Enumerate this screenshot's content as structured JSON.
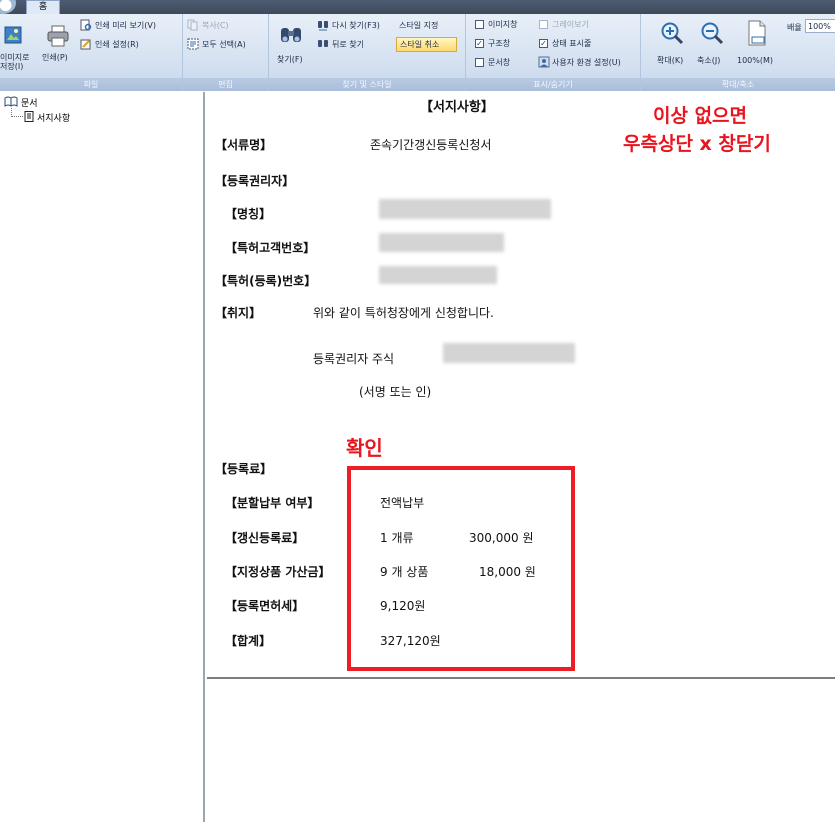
{
  "tab": {
    "home": "홈"
  },
  "ribbon": {
    "file": {
      "label": "파일",
      "save_image_line1": "이미지로",
      "save_image_line2": "저장(I)",
      "print": "인쇄(P)",
      "print_preview": "인쇄 미리 보기(V)",
      "print_settings": "인쇄 설정(R)"
    },
    "edit": {
      "label": "편집",
      "copy": "복사(C)",
      "select_all": "모두 선택(A)"
    },
    "find": {
      "label": "찾기 및 스타일",
      "find": "찾기(F)",
      "find_again": "다시 찾기(F3)",
      "find_back": "뒤로 찾기",
      "style_set": "스타일 지정",
      "style_cancel": "스타일 취소"
    },
    "view": {
      "label": "표시/숨기기",
      "image_pane": "이미지창",
      "grayscale": "그레이보기",
      "structure_pane": "구조창",
      "status_bar": "상태 표시줄",
      "document_pane": "문서창",
      "user_settings": "사용자 환경 설정(U)",
      "checked": {
        "image_pane": false,
        "grayscale": false,
        "structure_pane": true,
        "status_bar": true,
        "document_pane": false
      }
    },
    "zoom": {
      "label": "확대/축소",
      "zoom_in": "확대(K)",
      "zoom_out": "축소(J)",
      "zoom_100": "100%(M)",
      "ratio_label": "배율",
      "ratio_value": "100%"
    }
  },
  "tree": {
    "root": "문서",
    "child": "서지사항"
  },
  "doc": {
    "title": "【서지사항】",
    "doc_name_label": "【서류명】",
    "doc_name_value": "존속기간갱신등록신청서",
    "holder_label": "【등록권리자】",
    "name_label": "【명칭】",
    "customer_no_label": "【특허고객번호】",
    "patent_no_label": "【특허(등록)번호】",
    "purpose_label": "【취지】",
    "purpose_text": "위와 같이 특허청장에게 신청합니다.",
    "signer_text": "등록권리자   주식",
    "signature_text": "(서명 또는 인)",
    "fee_label": "【등록료】",
    "installment_label": "【분할납부 여부】",
    "installment_value": "전액납부",
    "renewal_fee_label": "【갱신등록료】",
    "renewal_fee_count": "1 개류",
    "renewal_fee_amount": "300,000 원",
    "designated_fee_label": "【지정상품 가산금】",
    "designated_fee_count": "9 개 상품",
    "designated_fee_amount": "18,000 원",
    "license_tax_label": "【등록면허세】",
    "license_tax_value": "9,120원",
    "total_label": "【합계】",
    "total_value": "327,120원"
  },
  "annotations": {
    "note_line1": "이상 없으면",
    "note_line2": "우측상단 x 창닫기",
    "confirm": "확인",
    "color": "#e8141e"
  }
}
